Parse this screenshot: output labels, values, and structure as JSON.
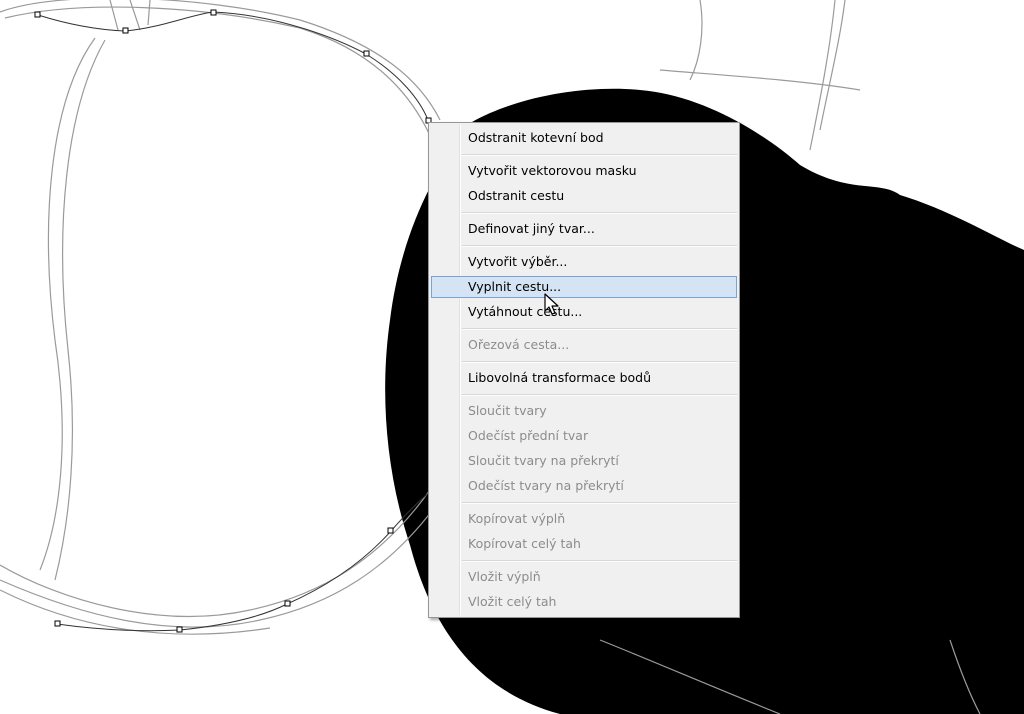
{
  "context_menu": {
    "items": [
      {
        "label": "Odstranit kotevní bod",
        "enabled": true
      },
      {
        "label": "Vytvořit vektorovou masku",
        "enabled": true
      },
      {
        "label": "Odstranit cestu",
        "enabled": true
      },
      {
        "label": "Definovat jiný tvar...",
        "enabled": true
      },
      {
        "label": "Vytvořit výběr...",
        "enabled": true
      },
      {
        "label": "Vyplnit cestu...",
        "enabled": true,
        "highlighted": true
      },
      {
        "label": "Vytáhnout cestu...",
        "enabled": true
      },
      {
        "label": "Ořezová cesta...",
        "enabled": false
      },
      {
        "label": "Libovolná transformace bodů",
        "enabled": true
      },
      {
        "label": "Sloučit tvary",
        "enabled": false
      },
      {
        "label": "Odečíst přední tvar",
        "enabled": false
      },
      {
        "label": "Sloučit tvary na překrytí",
        "enabled": false
      },
      {
        "label": "Odečíst tvary na překrytí",
        "enabled": false
      },
      {
        "label": "Kopírovat výplň",
        "enabled": false
      },
      {
        "label": "Kopírovat celý tah",
        "enabled": false
      },
      {
        "label": "Vložit výplň",
        "enabled": false
      },
      {
        "label": "Vložit celý tah",
        "enabled": false
      }
    ]
  },
  "colors": {
    "canvas_background": "#ffffff",
    "filled_shape": "#000000",
    "menu_background": "#f0f0f0",
    "highlight_background": "#d5e4f4",
    "highlight_border": "#7aa3d5",
    "disabled_text": "#8c8c8c"
  },
  "cursor": "arrow-pointer-icon"
}
